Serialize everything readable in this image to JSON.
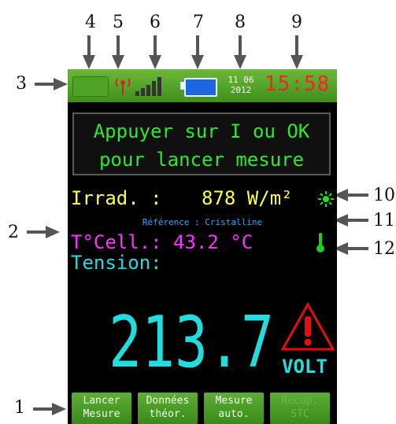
{
  "callouts": [
    "1",
    "2",
    "3",
    "4",
    "5",
    "6",
    "7",
    "8",
    "9",
    "10",
    "11",
    "12"
  ],
  "status_bar": {
    "date_day_month": "11 06",
    "date_year": "2012",
    "time": "15:58",
    "icons": [
      "battery-left-icon",
      "antenna-icon",
      "signal-bars-icon",
      "battery-icon"
    ]
  },
  "message": {
    "line1": "Appuyer sur I ou OK",
    "line2": "pour lancer mesure"
  },
  "irradiance": {
    "label": "Irrad. :",
    "value": "878 W/m²"
  },
  "reference": "Référence : Cristalline",
  "cell_temp": {
    "label": "T°Cell.: 43.2 °C"
  },
  "tension": {
    "label": "Tension:",
    "value": "213.7",
    "unit": "VOLT"
  },
  "softkeys": [
    {
      "line1": "Lancer",
      "line2": "Mesure"
    },
    {
      "line1": "Données",
      "line2": "théor."
    },
    {
      "line1": "Mesure",
      "line2": "auto."
    },
    {
      "line1": "Recup.",
      "line2": "STC"
    }
  ],
  "colors": {
    "status_green": "#4fa428",
    "clock_red": "#ff2020",
    "message_green": "#2de830",
    "irrad_yellow": "#ffff44",
    "ref_blue": "#2aa6ff",
    "tcell_magenta": "#ff33ff",
    "tension_cyan": "#22dddd",
    "warning_red": "#e01010"
  }
}
